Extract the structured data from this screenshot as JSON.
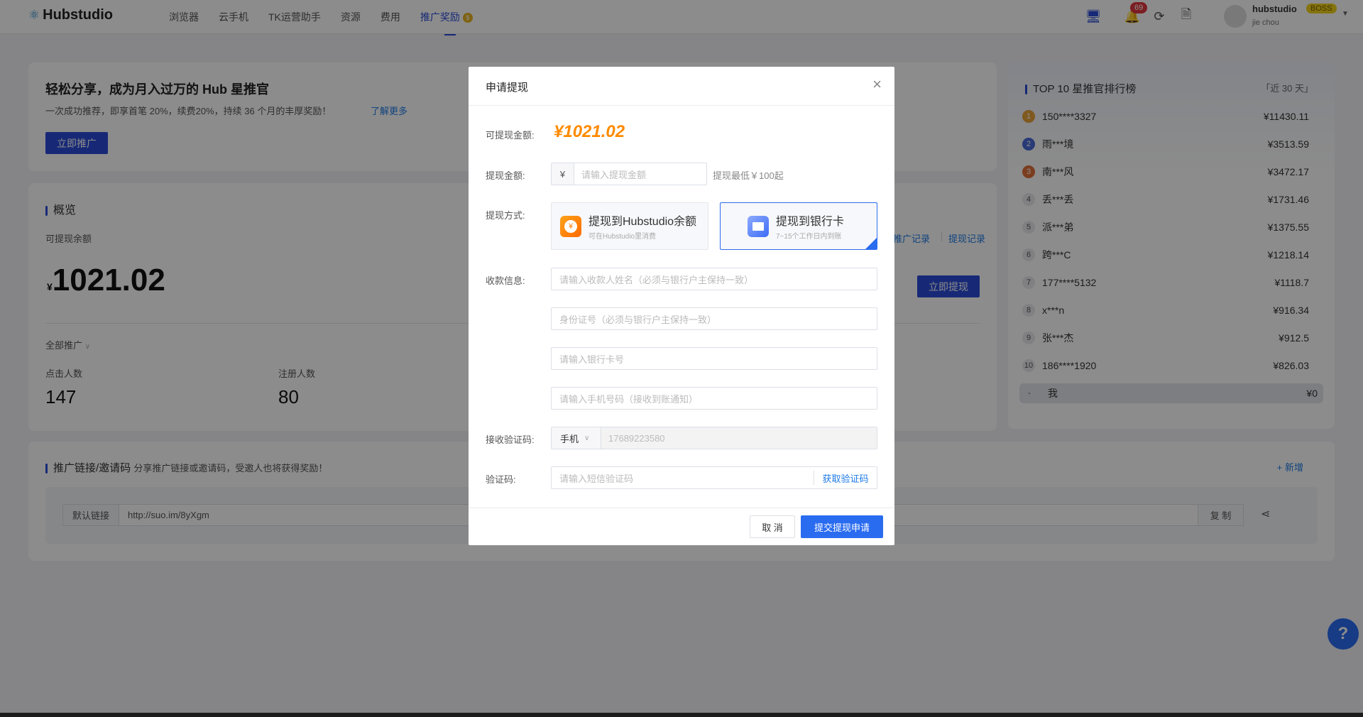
{
  "header": {
    "logo_text": "Hubstudio",
    "nav": [
      "浏览器",
      "云手机",
      "TK运营助手",
      "资源",
      "费用",
      "推广奖励"
    ],
    "notification_count": "69",
    "user_name": "hubstudio",
    "user_badge": "BOSS",
    "user_sub": "jie chou"
  },
  "banner": {
    "title": "轻松分享，成为月入过万的 Hub 星推官",
    "desc": "一次成功推荐，即享首笔 20%，续费20%，持续 36 个月的丰厚奖励！",
    "learn_more": "了解更多",
    "promote_button": "立即推广"
  },
  "overview": {
    "title": "概览",
    "balance_label": "可提现余额",
    "currency": "¥",
    "balance": "1021.02",
    "promo_record": "推广记录",
    "withdraw_record": "提现记录",
    "withdraw_button": "立即提现",
    "filter": "全部推广",
    "clicks_label": "点击人数",
    "clicks": "147",
    "registers_label": "注册人数",
    "registers": "80"
  },
  "ranking": {
    "title": "TOP 10 星推官排行榜",
    "period": "「近 30 天」",
    "rows": [
      {
        "rank": "1",
        "name": "150****3327",
        "amount": "¥11430.11"
      },
      {
        "rank": "2",
        "name": "雨***境",
        "amount": "¥3513.59"
      },
      {
        "rank": "3",
        "name": "南***风",
        "amount": "¥3472.17"
      },
      {
        "rank": "4",
        "name": "丢***丢",
        "amount": "¥1731.46"
      },
      {
        "rank": "5",
        "name": "派***弟",
        "amount": "¥1375.55"
      },
      {
        "rank": "6",
        "name": "跨***C",
        "amount": "¥1218.14"
      },
      {
        "rank": "7",
        "name": "177****5132",
        "amount": "¥1118.7"
      },
      {
        "rank": "8",
        "name": "x***n",
        "amount": "¥916.34"
      },
      {
        "rank": "9",
        "name": "张***杰",
        "amount": "¥912.5"
      },
      {
        "rank": "10",
        "name": "186****1920",
        "amount": "¥826.03"
      }
    ],
    "me": {
      "rank": "-",
      "name": "我",
      "amount": "¥0"
    },
    "medal_colors": [
      "#e8a23a",
      "#4a6ad8",
      "#e0703a"
    ]
  },
  "links": {
    "title": "推广链接/邀请码",
    "subtitle": "分享推广链接或邀请码，受邀人也将获得奖励！",
    "add": "+ 新增",
    "link_label": "默认链接",
    "link_value": "http://suo.im/8yXgm",
    "copy": "复 制"
  },
  "modal": {
    "title": "申请提现",
    "available_label": "可提现金额:",
    "available": "¥1021.02",
    "amount_label": "提现金额:",
    "amount_prefix": "¥",
    "amount_placeholder": "请输入提现金额",
    "amount_hint": "提现最低￥100起",
    "method_label": "提现方式:",
    "methods": [
      {
        "title": "提现到Hubstudio余额",
        "sub": "可在Hubstudio里消费",
        "selected": false
      },
      {
        "title": "提现到银行卡",
        "sub": "7~15个工作日内到账",
        "selected": true
      }
    ],
    "payee_label": "收款信息:",
    "name_placeholder": "请输入收款人姓名（必须与银行户主保持一致）",
    "id_placeholder": "身份证号（必须与银行户主保持一致）",
    "card_placeholder": "请输入银行卡号",
    "phone_placeholder": "请输入手机号码（接收到账通知）",
    "receive_label": "接收验证码:",
    "receive_type": "手机",
    "receive_phone": "17689223580",
    "code_label": "验证码:",
    "code_placeholder": "请输入短信验证码",
    "get_code": "获取验证码",
    "cancel": "取 消",
    "submit": "提交提现申请"
  },
  "colors": {
    "accent": "#2a4bd7",
    "amount": "#ff8a00",
    "link": "#1e7be6"
  }
}
